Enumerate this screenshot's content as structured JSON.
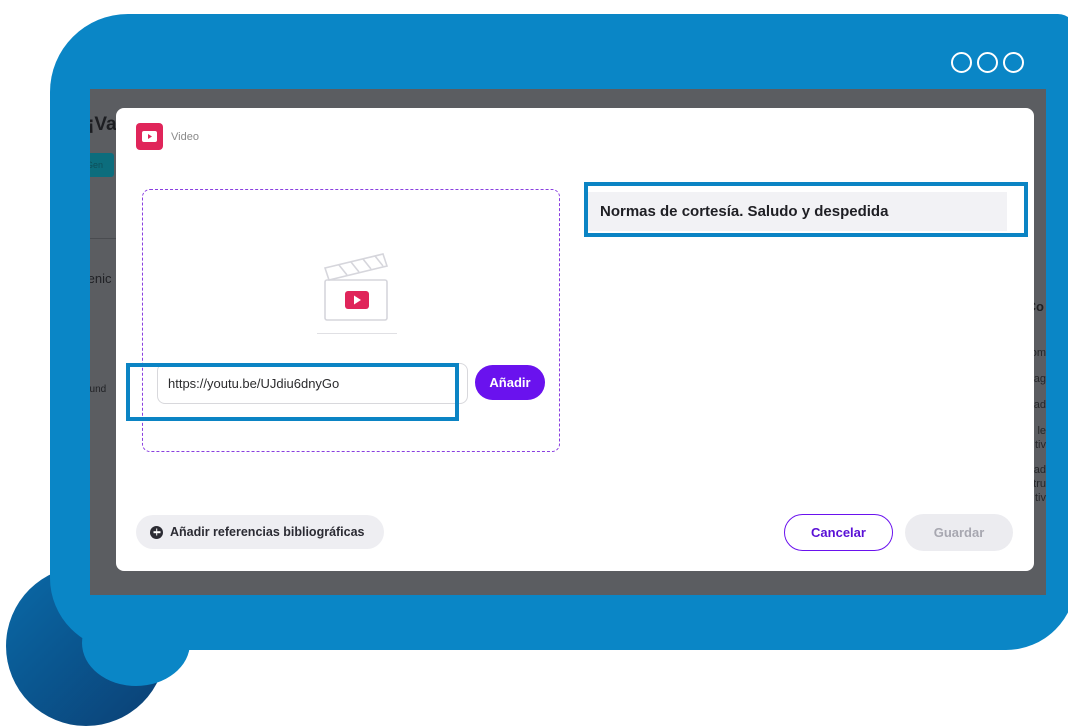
{
  "window": {
    "menu_icon": "three-circles"
  },
  "background": {
    "title_fragment": "¡Va",
    "chip_fragment": "Gen",
    "text_fragment_1": "tenic",
    "text_fragment_2": "gund",
    "right_fragment": "Co",
    "right_lines": [
      "om",
      "ag",
      "ad",
      "le",
      "tiv",
      "ad",
      "tru",
      "tiv"
    ]
  },
  "modal": {
    "header": {
      "icon": "video-play-icon",
      "label": "Video"
    },
    "dropzone": {
      "placeholder_icon": "clapperboard-play-icon",
      "url_value": "https://youtu.be/UJdiu6dnyGo",
      "add_label": "Añadir"
    },
    "title_value": "Normas de cortesía. Saludo y despedida",
    "footer": {
      "references_label": "Añadir referencias bibliográficas",
      "cancel_label": "Cancelar",
      "save_label": "Guardar"
    }
  },
  "colors": {
    "frame": "#0a86c6",
    "accent": "#6a12ee",
    "video_icon": "#e0255a",
    "highlight": "#0b84c4"
  }
}
